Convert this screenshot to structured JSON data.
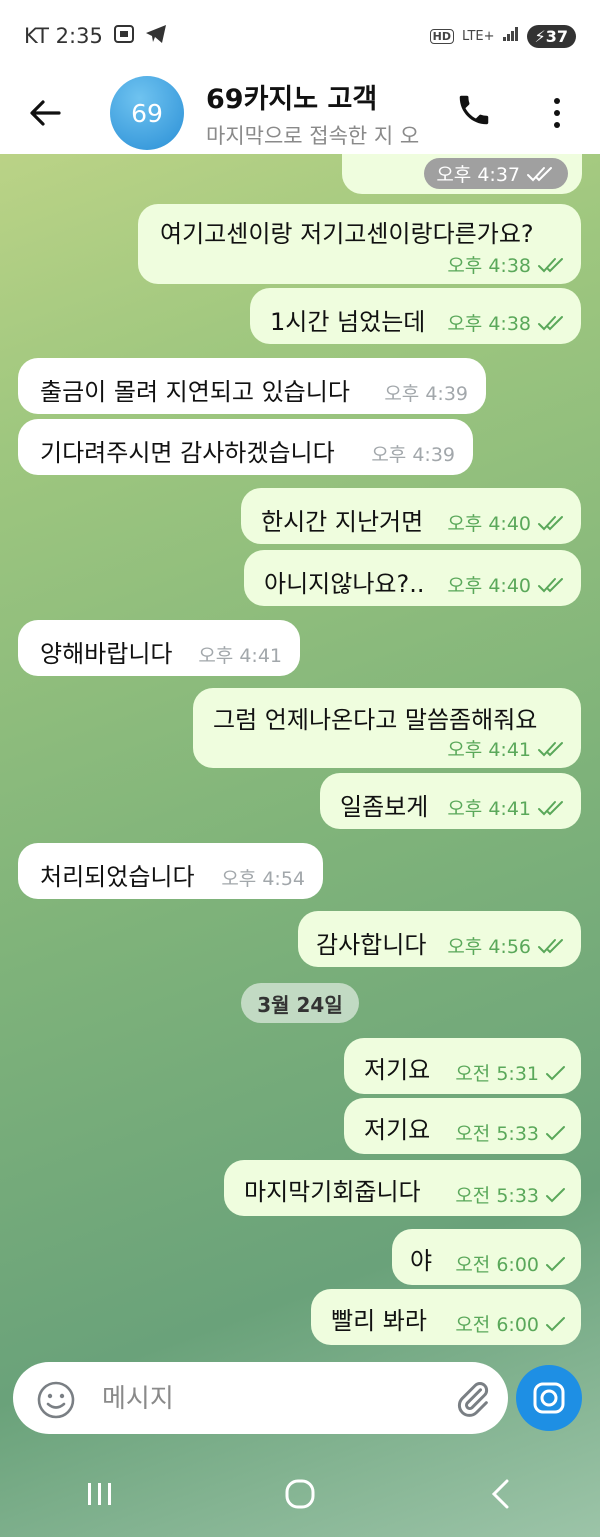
{
  "status_bar": {
    "carrier_time": "KT 2:35",
    "network": "LTE+",
    "battery": "37"
  },
  "header": {
    "avatar_text": "69",
    "title": "69카지노 고객",
    "subtitle": "마지막으로 접속한 지 오"
  },
  "top_partial_time": "오후 4:37",
  "messages": [
    {
      "dir": "out",
      "text": "여기고센이랑 저기고센이랑다른가요?",
      "time": "오후 4:38",
      "read": true
    },
    {
      "dir": "out",
      "text": "1시간 넘었는데",
      "time": "오후 4:38",
      "read": true
    },
    {
      "dir": "in",
      "text": "출금이 몰려 지연되고 있습니다",
      "time": "오후 4:39"
    },
    {
      "dir": "in",
      "text": "기다려주시면 감사하겠습니다",
      "time": "오후 4:39"
    },
    {
      "dir": "out",
      "text": "한시간 지난거면",
      "time": "오후 4:40",
      "read": true
    },
    {
      "dir": "out",
      "text": "아니지않나요?..",
      "time": "오후 4:40",
      "read": true
    },
    {
      "dir": "in",
      "text": "양해바랍니다",
      "time": "오후 4:41"
    },
    {
      "dir": "out",
      "text": "그럼 언제나온다고 말씀좀해줘요",
      "time": "오후 4:41",
      "read": true
    },
    {
      "dir": "out",
      "text": "일좀보게",
      "time": "오후 4:41",
      "read": true
    },
    {
      "dir": "in",
      "text": "처리되었습니다",
      "time": "오후 4:54"
    },
    {
      "dir": "out",
      "text": "감사합니다",
      "time": "오후 4:56",
      "read": true
    },
    {
      "dir": "out",
      "text": "저기요",
      "time": "오전 5:31",
      "read": false
    },
    {
      "dir": "out",
      "text": "저기요",
      "time": "오전 5:33",
      "read": false
    },
    {
      "dir": "out",
      "text": "마지막기회줍니다",
      "time": "오전 5:33",
      "read": false
    },
    {
      "dir": "out",
      "text": "야",
      "time": "오전 6:00",
      "read": false
    },
    {
      "dir": "out",
      "text": "빨리 봐라",
      "time": "오전 6:00",
      "read": false
    }
  ],
  "date_separator": "3월 24일",
  "composer": {
    "placeholder": "메시지"
  },
  "colors": {
    "outgoing_bubble": "#effdde",
    "incoming_bubble": "#ffffff",
    "accent": "#1e8fe4",
    "check_green": "#5aa85a"
  }
}
